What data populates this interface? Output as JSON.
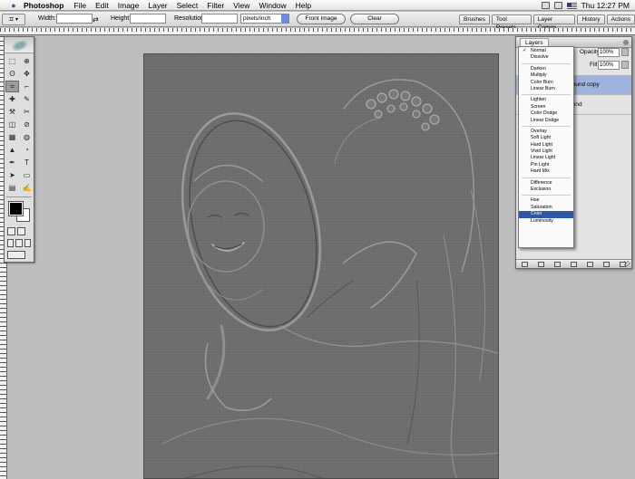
{
  "menubar": {
    "app_name": "Photoshop",
    "menus": [
      "File",
      "Edit",
      "Image",
      "Layer",
      "Select",
      "Filter",
      "View",
      "Window",
      "Help"
    ],
    "clock": "Thu 12:27 PM"
  },
  "options_bar": {
    "width_label": "Width:",
    "height_label": "Height:",
    "resolution_label": "Resolution:",
    "resolution_unit": "pixels/inch",
    "swap_glyph": "⇄",
    "front_image_button": "Front Image",
    "clear_button": "Clear"
  },
  "palette_well": {
    "tabs": [
      "Brushes",
      "Tool Presets",
      "Layer Comps",
      "History",
      "Actions"
    ]
  },
  "toolbox": {
    "tools": [
      "⬚",
      "⊕",
      "ʘ",
      "✥",
      "⌗",
      "⌐",
      "✚",
      "✎",
      "⚒",
      "✂",
      "◫",
      "⊘",
      "▦",
      "◍",
      "▲",
      "◔",
      "✒",
      "T",
      "➤",
      "▭",
      "▤",
      "✍",
      "⊡",
      "⚲",
      "✋",
      "⌕"
    ]
  },
  "layers_panel": {
    "tab_label": "Layers",
    "opacity_label": "Opacity:",
    "opacity_value": "100%",
    "fill_label": "Fill:",
    "fill_value": "100%",
    "layer_rows": [
      "ground copy",
      "round"
    ]
  },
  "blend_menu": {
    "selected": "Color",
    "checked": "Normal",
    "groups": [
      [
        "Normal",
        "Dissolve"
      ],
      [
        "Darken",
        "Multiply",
        "Color Burn",
        "Linear Burn"
      ],
      [
        "Lighten",
        "Screen",
        "Color Dodge",
        "Linear Dodge"
      ],
      [
        "Overlay",
        "Soft Light",
        "Hard Light",
        "Vivid Light",
        "Linear Light",
        "Pin Light",
        "Hard Mix"
      ],
      [
        "Difference",
        "Exclusion"
      ],
      [
        "Hue",
        "Saturation",
        "Color",
        "Luminosity"
      ]
    ]
  },
  "colors": {
    "menu_highlight": "#2f57a8",
    "selected_layer": "#9eb4de",
    "canvas_gray": "#6e6e6e",
    "workspace": "#bdbdbd"
  }
}
